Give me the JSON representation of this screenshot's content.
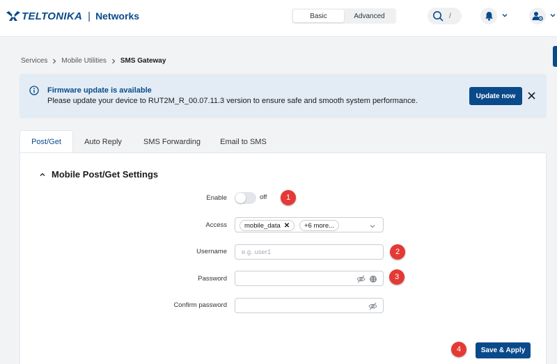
{
  "header": {
    "brand_name": "TELTONIKA",
    "brand_separator": "|",
    "brand_sub": "Networks",
    "mode_basic": "Basic",
    "mode_advanced": "Advanced",
    "search_shortcut": "/"
  },
  "breadcrumb": {
    "items": [
      "Services",
      "Mobile Utilities",
      "SMS Gateway"
    ]
  },
  "alert": {
    "title": "Firmware update is available",
    "message": "Please update your device to RUT2M_R_00.07.11.3 version to ensure safe and smooth system performance.",
    "button": "Update now"
  },
  "tabs": [
    "Post/Get",
    "Auto Reply",
    "SMS Forwarding",
    "Email to SMS"
  ],
  "section": {
    "title": "Mobile Post/Get Settings"
  },
  "form": {
    "enable_label": "Enable",
    "enable_state": "off",
    "access_label": "Access",
    "access_chip": "mobile_data",
    "access_more": "+6 more...",
    "username_label": "Username",
    "username_placeholder": "e.g. user1",
    "password_label": "Password",
    "confirm_label": "Confirm password"
  },
  "badges": [
    "1",
    "2",
    "3",
    "4"
  ],
  "actions": {
    "save": "Save & Apply"
  },
  "colors": {
    "brand": "#0a4a8a",
    "alert_bg": "#e3ecf5",
    "badge": "#e53935"
  }
}
